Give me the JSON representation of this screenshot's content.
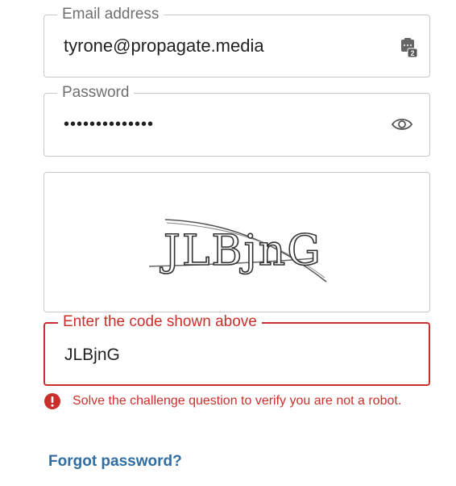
{
  "email": {
    "label": "Email address",
    "value": "tyrone@propagate.media",
    "icon": "password-manager-icon",
    "icon_badge": "2"
  },
  "password": {
    "label": "Password",
    "value": "••••••••••••••",
    "icon": "eye-icon"
  },
  "captcha": {
    "text": "JLBjnG",
    "icon": "captcha-image"
  },
  "code": {
    "label": "Enter the code shown above",
    "value": "JLBjnG"
  },
  "error": {
    "icon": "error-icon",
    "message": "Solve the challenge question to verify you are not a robot."
  },
  "links": {
    "forgot_password": "Forgot password?"
  },
  "colors": {
    "error": "#c9302c",
    "link": "#2f6da2",
    "border": "#c8c8c8",
    "label": "#6f6f6f"
  }
}
